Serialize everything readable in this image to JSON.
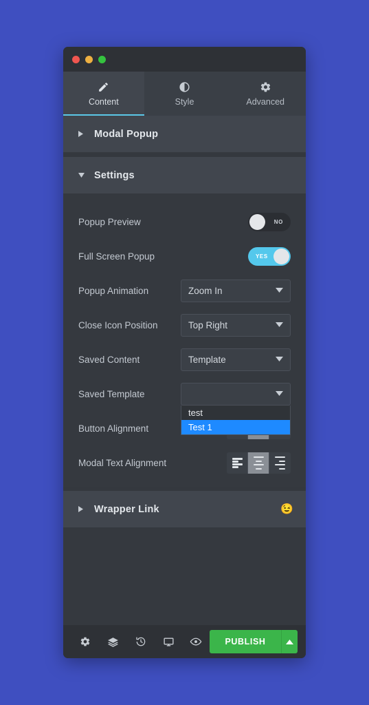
{
  "window": {
    "traffic_lights": [
      {
        "name": "close",
        "color": "#f05650"
      },
      {
        "name": "minimize",
        "color": "#edb042"
      },
      {
        "name": "maximize",
        "color": "#35c33f"
      }
    ]
  },
  "tabs": [
    {
      "label": "Content",
      "icon": "pencil-icon",
      "active": true
    },
    {
      "label": "Style",
      "icon": "contrast-icon",
      "active": false
    },
    {
      "label": "Advanced",
      "icon": "gear-icon",
      "active": false
    }
  ],
  "sections": {
    "modal_popup": {
      "title": "Modal Popup",
      "expanded": false
    },
    "settings": {
      "title": "Settings",
      "expanded": true
    },
    "wrapper_link": {
      "title": "Wrapper Link",
      "expanded": false,
      "emoji": "😉"
    }
  },
  "settings": {
    "popup_preview": {
      "label": "Popup Preview",
      "state": "NO",
      "on": false
    },
    "full_screen_popup": {
      "label": "Full Screen Popup",
      "state": "YES",
      "on": true
    },
    "popup_animation": {
      "label": "Popup Animation",
      "value": "Zoom In"
    },
    "close_icon_position": {
      "label": "Close Icon Position",
      "value": "Top Right"
    },
    "saved_content": {
      "label": "Saved Content",
      "value": "Template"
    },
    "saved_template": {
      "label": "Saved Template",
      "value": "",
      "open": true,
      "options": [
        {
          "label": "test",
          "selected": false
        },
        {
          "label": "Test 1",
          "selected": true
        }
      ]
    },
    "button_alignment": {
      "label": "Button Alignment",
      "value": "center"
    },
    "modal_text_alignment": {
      "label": "Modal Text Alignment",
      "value": "center"
    }
  },
  "toolbar": {
    "tools": [
      {
        "name": "settings-icon"
      },
      {
        "name": "layers-icon"
      },
      {
        "name": "history-icon"
      },
      {
        "name": "responsive-icon"
      },
      {
        "name": "preview-icon"
      }
    ],
    "publish_label": "PUBLISH",
    "publish_color": "#3bb54a"
  },
  "colors": {
    "page_background": "#3f4fc0",
    "panel": "#35393f",
    "accent_cyan": "#54c8ec",
    "highlight_blue": "#1e8aff"
  }
}
